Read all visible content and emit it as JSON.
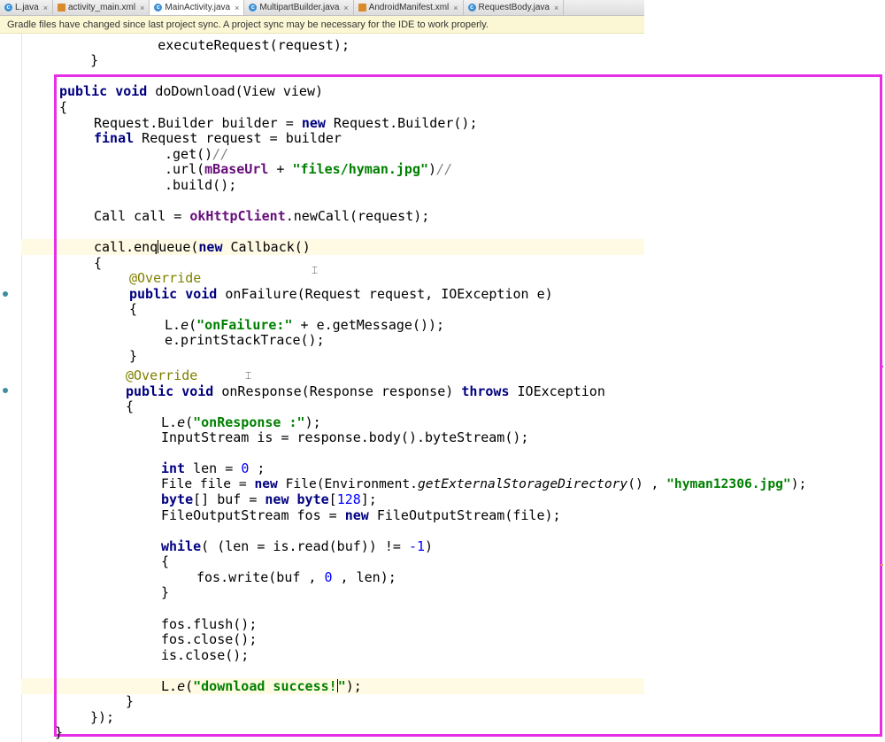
{
  "tabs": [
    {
      "label": "L.java",
      "icon": "java-class-icon",
      "active": false
    },
    {
      "label": "activity_main.xml",
      "icon": "xml-file-icon",
      "active": false
    },
    {
      "label": "MainActivity.java",
      "icon": "java-class-icon",
      "active": true
    },
    {
      "label": "MultipartBuilder.java",
      "icon": "java-class-icon",
      "active": false
    },
    {
      "label": "AndroidManifest.xml",
      "icon": "xml-file-icon",
      "active": false
    },
    {
      "label": "RequestBody.java",
      "icon": "java-class-icon",
      "active": false
    }
  ],
  "tab_close_glyph": "×",
  "notification": "Gradle files have changed since last project sync. A project sync may be necessary for the IDE to work properly.",
  "code": {
    "l01": {
      "a": "        executeRequest(request);"
    },
    "l02": {
      "a": "    }"
    },
    "l03": {
      "k1": "public",
      "s1": " ",
      "k2": "void",
      "a": " doDownload(View view)"
    },
    "l04": {
      "a": "    {"
    },
    "l05": {
      "a": "        Request.Builder builder = ",
      "k": "new",
      "b": " Request.Builder();"
    },
    "l06": {
      "k": "final",
      "a": " Request request = builder"
    },
    "l07": {
      "a": "                .get()",
      "c": "//"
    },
    "l08": {
      "a": "                .url(",
      "f": "mBaseUrl",
      "b": " + ",
      "s": "\"files/hyman.jpg\"",
      "c2": ")",
      "c": "//"
    },
    "l09": {
      "a": "                .build();"
    },
    "l10": {
      "a": "        Call call = ",
      "f": "okHttpClient",
      "b": ".newCall(request);"
    },
    "l11a": {
      "a": "        call.enq"
    },
    "l11b": {
      "a": "ueue(",
      "k": "new",
      "b": " Callback()"
    },
    "l12": {
      "a": "        {"
    },
    "l13": {
      "an": "@Override"
    },
    "l14": {
      "k1": "public",
      "k2": "void",
      "a": " onFailure(Request request, IOException e)"
    },
    "l15": {
      "a": "            {"
    },
    "l16": {
      "a": "L.",
      "i": "e",
      "b": "(",
      "s": "\"onFailure:\"",
      "c": " + e.getMessage());"
    },
    "l17": {
      "a": "e.printStackTrace();"
    },
    "l18": {
      "a": "}"
    },
    "l19": {
      "an": "@Override"
    },
    "l20": {
      "k1": "public",
      "k2": "void",
      "a": " onResponse(Response response) ",
      "k3": "throws",
      "b": " IOException"
    },
    "l21": {
      "a": "{"
    },
    "l22": {
      "a": "L.",
      "i": "e",
      "b": "(",
      "s": "\"onResponse :\"",
      "c": ");"
    },
    "l23": {
      "a": "InputStream is = response.body().byteStream();"
    },
    "l24": {
      "k": "int",
      "a": " len = ",
      "n": "0",
      "b": " ;"
    },
    "l25": {
      "a": "File file = ",
      "k": "new",
      "b": " File(Environment.",
      "i": "getExternalStorageDirectory",
      "c": "() , ",
      "s": "\"hyman12306.jpg\"",
      "d": ");"
    },
    "l26": {
      "k": "byte",
      "a": "[] buf = ",
      "k2": "new",
      "k3": "byte",
      "b": "[",
      "n": "128",
      "c": "];"
    },
    "l27": {
      "a": "FileOutputStream fos = ",
      "k": "new",
      "b": " FileOutputStream(file);"
    },
    "l28": {
      "k": "while",
      "a": "( (len = is.read(buf)) != ",
      "n": "-1",
      "b": ")"
    },
    "l29": {
      "a": "{"
    },
    "l30": {
      "a": "fos.write(buf , ",
      "n": "0",
      "b": " , len);"
    },
    "l31": {
      "a": "}"
    },
    "l32": {
      "a": "fos.flush();"
    },
    "l33": {
      "a": "fos.close();"
    },
    "l34": {
      "a": "is.close();"
    },
    "l35": {
      "a": "L.",
      "i": "e",
      "b": "(",
      "s": "\"download success!",
      "s2": "\"",
      "c": ");"
    },
    "l36": {
      "a": "}"
    },
    "l37": {
      "a": "});"
    },
    "l38": {
      "a": "}"
    }
  },
  "colors": {
    "keyword": "#000080",
    "string": "#008000",
    "field": "#660e7a",
    "annotation": "#808000",
    "number": "#0000ff",
    "comment": "#808080",
    "highlight_frame": "#e62ee6",
    "notification_bg": "#fbf7d4"
  }
}
